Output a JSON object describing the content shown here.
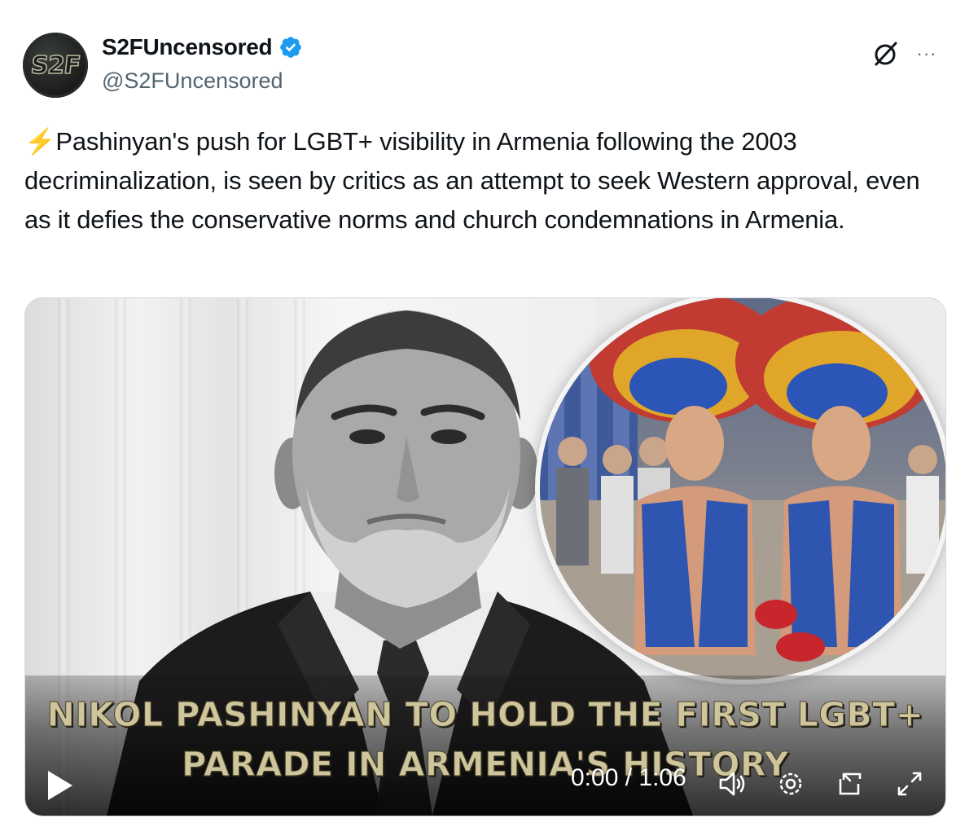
{
  "author": {
    "display_name": "S2FUncensored",
    "handle": "@S2FUncensored",
    "avatar_text": "S2F",
    "verified": true,
    "verified_color": "#1d9bf0"
  },
  "actions": {
    "grok_icon": "grok-slash-circle-icon",
    "more_label": "···"
  },
  "tweet": {
    "emoji": "⚡",
    "text": "Pashinyan's push for LGBT+ visibility in Armenia following the 2003 decriminalization, is seen by critics as an attempt to seek Western approval, even as it defies the conservative norms and church condemnations in Armenia."
  },
  "video": {
    "headline_line1": "NIKOL PASHINYAN TO HOLD THE FIRST LGBT+",
    "headline_line2": "PARADE IN ARMENIA'S HISTORY",
    "time_display": "0:00 / 1:06",
    "icons": [
      "play-icon",
      "volume-icon",
      "settings-gear-icon",
      "picture-in-picture-icon",
      "fullscreen-icon"
    ]
  }
}
